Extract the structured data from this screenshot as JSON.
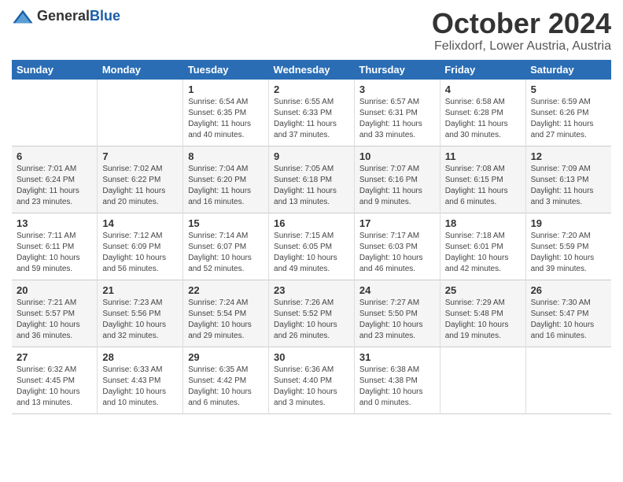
{
  "header": {
    "logo": {
      "general": "General",
      "blue": "Blue"
    },
    "title": "October 2024",
    "location": "Felixdorf, Lower Austria, Austria"
  },
  "calendar": {
    "days_of_week": [
      "Sunday",
      "Monday",
      "Tuesday",
      "Wednesday",
      "Thursday",
      "Friday",
      "Saturday"
    ],
    "weeks": [
      [
        {
          "day": "",
          "info": ""
        },
        {
          "day": "",
          "info": ""
        },
        {
          "day": "1",
          "info": "Sunrise: 6:54 AM\nSunset: 6:35 PM\nDaylight: 11 hours\nand 40 minutes."
        },
        {
          "day": "2",
          "info": "Sunrise: 6:55 AM\nSunset: 6:33 PM\nDaylight: 11 hours\nand 37 minutes."
        },
        {
          "day": "3",
          "info": "Sunrise: 6:57 AM\nSunset: 6:31 PM\nDaylight: 11 hours\nand 33 minutes."
        },
        {
          "day": "4",
          "info": "Sunrise: 6:58 AM\nSunset: 6:28 PM\nDaylight: 11 hours\nand 30 minutes."
        },
        {
          "day": "5",
          "info": "Sunrise: 6:59 AM\nSunset: 6:26 PM\nDaylight: 11 hours\nand 27 minutes."
        }
      ],
      [
        {
          "day": "6",
          "info": "Sunrise: 7:01 AM\nSunset: 6:24 PM\nDaylight: 11 hours\nand 23 minutes."
        },
        {
          "day": "7",
          "info": "Sunrise: 7:02 AM\nSunset: 6:22 PM\nDaylight: 11 hours\nand 20 minutes."
        },
        {
          "day": "8",
          "info": "Sunrise: 7:04 AM\nSunset: 6:20 PM\nDaylight: 11 hours\nand 16 minutes."
        },
        {
          "day": "9",
          "info": "Sunrise: 7:05 AM\nSunset: 6:18 PM\nDaylight: 11 hours\nand 13 minutes."
        },
        {
          "day": "10",
          "info": "Sunrise: 7:07 AM\nSunset: 6:16 PM\nDaylight: 11 hours\nand 9 minutes."
        },
        {
          "day": "11",
          "info": "Sunrise: 7:08 AM\nSunset: 6:15 PM\nDaylight: 11 hours\nand 6 minutes."
        },
        {
          "day": "12",
          "info": "Sunrise: 7:09 AM\nSunset: 6:13 PM\nDaylight: 11 hours\nand 3 minutes."
        }
      ],
      [
        {
          "day": "13",
          "info": "Sunrise: 7:11 AM\nSunset: 6:11 PM\nDaylight: 10 hours\nand 59 minutes."
        },
        {
          "day": "14",
          "info": "Sunrise: 7:12 AM\nSunset: 6:09 PM\nDaylight: 10 hours\nand 56 minutes."
        },
        {
          "day": "15",
          "info": "Sunrise: 7:14 AM\nSunset: 6:07 PM\nDaylight: 10 hours\nand 52 minutes."
        },
        {
          "day": "16",
          "info": "Sunrise: 7:15 AM\nSunset: 6:05 PM\nDaylight: 10 hours\nand 49 minutes."
        },
        {
          "day": "17",
          "info": "Sunrise: 7:17 AM\nSunset: 6:03 PM\nDaylight: 10 hours\nand 46 minutes."
        },
        {
          "day": "18",
          "info": "Sunrise: 7:18 AM\nSunset: 6:01 PM\nDaylight: 10 hours\nand 42 minutes."
        },
        {
          "day": "19",
          "info": "Sunrise: 7:20 AM\nSunset: 5:59 PM\nDaylight: 10 hours\nand 39 minutes."
        }
      ],
      [
        {
          "day": "20",
          "info": "Sunrise: 7:21 AM\nSunset: 5:57 PM\nDaylight: 10 hours\nand 36 minutes."
        },
        {
          "day": "21",
          "info": "Sunrise: 7:23 AM\nSunset: 5:56 PM\nDaylight: 10 hours\nand 32 minutes."
        },
        {
          "day": "22",
          "info": "Sunrise: 7:24 AM\nSunset: 5:54 PM\nDaylight: 10 hours\nand 29 minutes."
        },
        {
          "day": "23",
          "info": "Sunrise: 7:26 AM\nSunset: 5:52 PM\nDaylight: 10 hours\nand 26 minutes."
        },
        {
          "day": "24",
          "info": "Sunrise: 7:27 AM\nSunset: 5:50 PM\nDaylight: 10 hours\nand 23 minutes."
        },
        {
          "day": "25",
          "info": "Sunrise: 7:29 AM\nSunset: 5:48 PM\nDaylight: 10 hours\nand 19 minutes."
        },
        {
          "day": "26",
          "info": "Sunrise: 7:30 AM\nSunset: 5:47 PM\nDaylight: 10 hours\nand 16 minutes."
        }
      ],
      [
        {
          "day": "27",
          "info": "Sunrise: 6:32 AM\nSunset: 4:45 PM\nDaylight: 10 hours\nand 13 minutes."
        },
        {
          "day": "28",
          "info": "Sunrise: 6:33 AM\nSunset: 4:43 PM\nDaylight: 10 hours\nand 10 minutes."
        },
        {
          "day": "29",
          "info": "Sunrise: 6:35 AM\nSunset: 4:42 PM\nDaylight: 10 hours\nand 6 minutes."
        },
        {
          "day": "30",
          "info": "Sunrise: 6:36 AM\nSunset: 4:40 PM\nDaylight: 10 hours\nand 3 minutes."
        },
        {
          "day": "31",
          "info": "Sunrise: 6:38 AM\nSunset: 4:38 PM\nDaylight: 10 hours\nand 0 minutes."
        },
        {
          "day": "",
          "info": ""
        },
        {
          "day": "",
          "info": ""
        }
      ]
    ]
  }
}
